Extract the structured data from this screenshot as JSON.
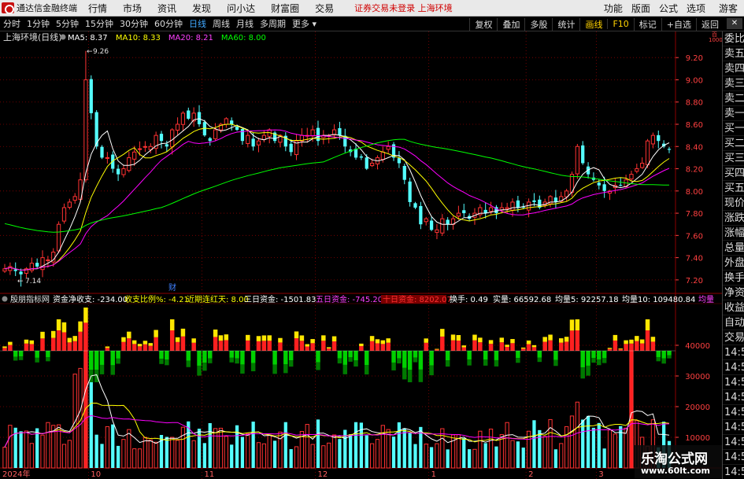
{
  "menubar": {
    "app_title": "通达信金融终端",
    "items": [
      "行情",
      "市场",
      "资讯",
      "发现",
      "问小达",
      "财富圈",
      "交易"
    ],
    "notice": "证券交易未登录  上海环境",
    "right_items": [
      "功能",
      "版面",
      "公式",
      "选项"
    ],
    "guest_label": "游客"
  },
  "toolbar": {
    "periods": [
      "分时",
      "1分钟",
      "5分钟",
      "15分钟",
      "30分钟",
      "60分钟",
      "日线",
      "周线",
      "月线",
      "多周期",
      "更多 ▾"
    ],
    "active_period": "日线",
    "tools": [
      "复权",
      "叠加",
      "多股",
      "统计",
      "画线",
      "F10",
      "标记",
      "+自选",
      "返回"
    ],
    "active_tools": [
      "画线",
      "F10"
    ],
    "close_label": "✕"
  },
  "colors": {
    "up": "#ff3232",
    "down": "#54ffff",
    "ma5": "#ffffff",
    "ma10": "#ffff00",
    "ma20": "#ff00ff",
    "ma60": "#00ff00",
    "grid": "#8b0000",
    "axis_text": "#ff4040",
    "bright_red": "#ff2020",
    "bright_yellow": "#ffe600",
    "bright_green": "#00d000",
    "dark_green": "#007a00"
  },
  "price_panel": {
    "title": "上海环境(日线)",
    "ma_labels": [
      {
        "name": "MA5:",
        "value": "8.37",
        "color": "#ffffff"
      },
      {
        "name": "MA10:",
        "value": "8.33",
        "color": "#ffff00"
      },
      {
        "name": "MA20:",
        "value": "8.21",
        "color": "#ff40ff"
      },
      {
        "name": "MA60:",
        "value": "8.00",
        "color": "#00ff00"
      }
    ],
    "annotation_high": "9.26",
    "annotation_low": "7.14",
    "cai_label": "财",
    "top_right_unit": "百",
    "top_right_unit2": "1000"
  },
  "indicator_panel": {
    "name": "殷朋指标网",
    "fields": [
      {
        "label": "资金净收支:",
        "value": "-234.00",
        "color": "#ffffff"
      },
      {
        "label": "收支比例%:",
        "value": "-4.21",
        "color": "#ffff00"
      },
      {
        "label": "近期连红天:",
        "value": "8.00",
        "color": "#ffff00"
      },
      {
        "label": "三日资金:",
        "value": "-1501.83",
        "color": "#ffffff"
      },
      {
        "label": "五日资金:",
        "value": "-745.20",
        "color": "#ff40ff"
      },
      {
        "label": "十日资金:",
        "value": "8202.07",
        "color": "#ff3030",
        "badge": true
      },
      {
        "label": "换手:",
        "value": "0.49",
        "color": "#ffffff"
      },
      {
        "label": "实量:",
        "value": "66592.68",
        "color": "#ffffff"
      },
      {
        "label": "均量5:",
        "value": "92257.18",
        "color": "#ffffff"
      },
      {
        "label": "均量10:",
        "value": "109480.84",
        "color": "#ffffff"
      },
      {
        "label": "均量",
        "value": "",
        "color": "#ff40ff"
      }
    ]
  },
  "axis": {
    "price_ticks": [
      "9.20",
      "9.00",
      "8.80",
      "8.60",
      "8.40",
      "8.20",
      "8.00",
      "7.80",
      "7.60",
      "7.40",
      "7.20"
    ],
    "volume_ticks": [
      "40000",
      "30000",
      "20000",
      "10000"
    ],
    "x_labels": [
      "2024年",
      "10",
      "11",
      "12",
      "1",
      "2",
      "3"
    ]
  },
  "right_panel": {
    "upper": [
      "委比",
      "卖五",
      "卖四",
      "卖三",
      "卖二",
      "卖一",
      "买一",
      "买二",
      "买三",
      "买四",
      "买五",
      "现价",
      "涨跌",
      "涨幅",
      "总量",
      "外盘",
      "换手",
      "净资",
      "收益"
    ],
    "lower": [
      "自动",
      "交易",
      "14:56",
      "14:56",
      "14:56",
      "14:56",
      "14:56",
      "14:56",
      "14:56",
      "14:56",
      "14:56"
    ]
  },
  "watermark": {
    "line1": "乐淘公式网",
    "line2": "www.60lt.com"
  },
  "chart_data": {
    "type": "candlestick",
    "title": "上海环境(日线)",
    "period": "日线",
    "x_axis_months": [
      "2024年",
      "10",
      "11",
      "12",
      "1",
      "2",
      "3"
    ],
    "price_range": [
      7.1,
      9.35
    ],
    "price_high_marker": 9.26,
    "price_low_marker": 7.14,
    "latest_ma": {
      "MA5": 8.37,
      "MA10": 8.33,
      "MA20": 8.21,
      "MA60": 8.0
    },
    "close_series": [
      7.3,
      7.32,
      7.28,
      7.25,
      7.3,
      7.35,
      7.32,
      7.4,
      7.38,
      7.45,
      7.7,
      7.85,
      7.9,
      7.95,
      8.1,
      9.0,
      8.7,
      8.4,
      8.3,
      8.3,
      8.2,
      8.15,
      8.2,
      8.3,
      8.35,
      8.38,
      8.4,
      8.4,
      8.5,
      8.45,
      8.4,
      8.55,
      8.6,
      8.7,
      8.65,
      8.7,
      8.6,
      8.5,
      8.45,
      8.55,
      8.6,
      8.65,
      8.6,
      8.55,
      8.45,
      8.5,
      8.4,
      8.45,
      8.5,
      8.55,
      8.45,
      8.5,
      8.4,
      8.35,
      8.45,
      8.5,
      8.5,
      8.55,
      8.45,
      8.5,
      8.5,
      8.55,
      8.5,
      8.4,
      8.35,
      8.3,
      8.3,
      8.2,
      8.25,
      8.3,
      8.35,
      8.4,
      8.3,
      8.25,
      8.1,
      7.9,
      7.85,
      7.7,
      7.75,
      7.65,
      7.65,
      7.75,
      7.7,
      7.75,
      7.8,
      7.8,
      7.75,
      7.8,
      7.85,
      7.8,
      7.85,
      7.8,
      7.85,
      7.85,
      7.9,
      7.85,
      7.85,
      7.9,
      7.9,
      7.85,
      7.9,
      7.95,
      7.9,
      7.95,
      8.0,
      8.15,
      8.4,
      8.25,
      8.15,
      8.1,
      8.05,
      8.0,
      8.0,
      8.05,
      8.05,
      8.1,
      8.15,
      8.2,
      8.25,
      8.45,
      8.5,
      8.45,
      8.4,
      8.37
    ],
    "indicator_name": "殷朋指标网",
    "indicator_latest": {
      "资金净收支": -234.0,
      "收支比例%": -4.21,
      "近期连红天": 8.0,
      "三日资金": -1501.83,
      "五日资金": -745.2,
      "十日资金": 8202.07,
      "换手": 0.49,
      "实量": 66592.68,
      "均量5": 92257.18,
      "均量10": 109480.84
    },
    "volume_range": [
      0,
      50000
    ]
  }
}
